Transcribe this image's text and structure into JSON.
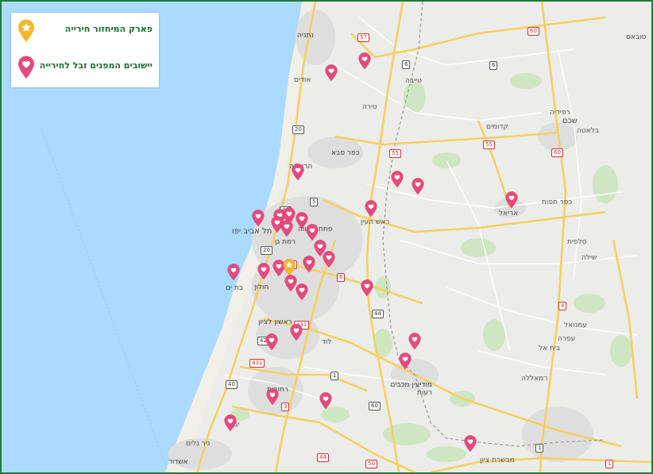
{
  "legend": {
    "recycling_park_label": "פארק המיחזור חירייה",
    "settlements_label": "יישובים המפנים זבל לחירייה"
  },
  "colors": {
    "sea": "#aadaff",
    "land": "#ececea",
    "green_area": "#cfe6c2",
    "urban": "#dddddd",
    "road_major": "#f7cf60",
    "road_minor": "#ffffff",
    "pin_settlement": "#e8487d",
    "pin_recycling": "#f3b72d",
    "border": "#1e7a36"
  },
  "icons": {
    "recycling_pin": "star-pin-icon",
    "settlement_pin": "heart-pin-icon"
  },
  "places": [
    {
      "name": "נתניה"
    },
    {
      "name": "טובאס"
    },
    {
      "name": "אודים"
    },
    {
      "name": "טייבה"
    },
    {
      "name": "טירה"
    },
    {
      "name": "קדומים"
    },
    {
      "name": "רפידיה"
    },
    {
      "name": "שכם"
    },
    {
      "name": "בלאטה"
    },
    {
      "name": "כפר סבא"
    },
    {
      "name": "הרצליה"
    },
    {
      "name": "ראש העין"
    },
    {
      "name": "פתח תקווה"
    },
    {
      "name": "תל אביב יפו"
    },
    {
      "name": "רמת גן"
    },
    {
      "name": "אריאל"
    },
    {
      "name": "כפר תפוח"
    },
    {
      "name": "סלפית"
    },
    {
      "name": "שילה"
    },
    {
      "name": "חולון"
    },
    {
      "name": "בת ים"
    },
    {
      "name": "ראשון לציון"
    },
    {
      "name": "לוד"
    },
    {
      "name": "עמנואל"
    },
    {
      "name": "עפרה"
    },
    {
      "name": "בית אל"
    },
    {
      "name": "רמאללה"
    },
    {
      "name": "מודיעין מכבים רעות"
    },
    {
      "name": "רחובות"
    },
    {
      "name": "יבנה"
    },
    {
      "name": "ניר גלים"
    },
    {
      "name": "אשדוד"
    },
    {
      "name": "מבשרת ציון"
    }
  ],
  "road_shields": [
    "57",
    "60",
    "6",
    "6",
    "20",
    "55",
    "55",
    "5",
    "60",
    "40",
    "20",
    "4",
    "6",
    "44",
    "431",
    "42",
    "431",
    "1",
    "60",
    "4",
    "40",
    "3",
    "44",
    "50",
    "1",
    "1"
  ],
  "pins": {
    "recycling": {
      "name": "פארק המיחזור חירייה"
    },
    "settlements_count": 35
  }
}
